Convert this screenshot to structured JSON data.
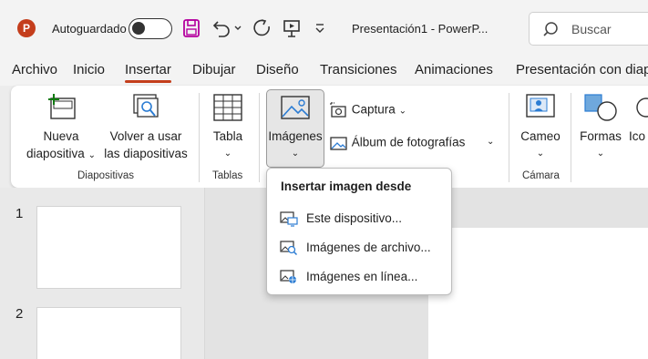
{
  "app": {
    "logo_letter": "P",
    "accent": "#c43e1c"
  },
  "titlebar": {
    "autosave_label": "Autoguardado",
    "doc_title": "Presentación1  -  PowerP...",
    "search_placeholder": "Buscar"
  },
  "tabs": [
    {
      "label": "Archivo"
    },
    {
      "label": "Inicio"
    },
    {
      "label": "Insertar",
      "active": true
    },
    {
      "label": "Dibujar"
    },
    {
      "label": "Diseño"
    },
    {
      "label": "Transiciones"
    },
    {
      "label": "Animaciones"
    },
    {
      "label": "Presentación con diap"
    }
  ],
  "ribbon": {
    "new_slide_line1": "Nueva",
    "new_slide_line2": "diapositiva",
    "reuse_line1": "Volver a usar",
    "reuse_line2": "las diapositivas",
    "group_slides": "Diapositivas",
    "table_label": "Tabla",
    "group_tables": "Tablas",
    "images_label": "Imágenes",
    "capture_label": "Captura",
    "album_label": "Álbum de fotografías",
    "camera_label": "Cameo",
    "group_camera": "Cámara",
    "shapes_label": "Formas",
    "icons_label": "Ico"
  },
  "menu": {
    "header": "Insertar imagen desde",
    "items": [
      {
        "label": "Este dispositivo...",
        "icon": "device-image-icon"
      },
      {
        "label": "Imágenes de archivo...",
        "icon": "stock-images-icon"
      },
      {
        "label": "Imágenes en línea...",
        "icon": "online-images-icon"
      }
    ]
  },
  "thumbnails": [
    {
      "number": "1"
    },
    {
      "number": "2"
    }
  ]
}
